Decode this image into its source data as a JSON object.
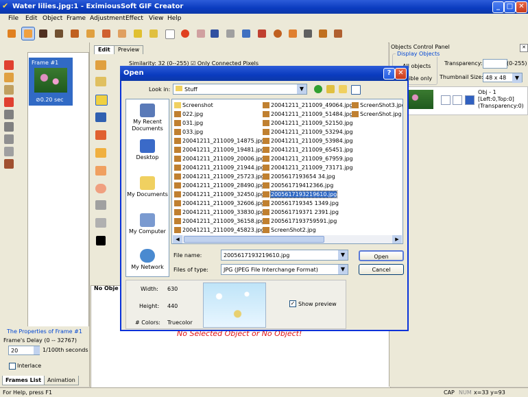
{
  "window": {
    "title": "Water lilies.jpg:1 - EximiousSoft GIF Creator"
  },
  "menu": [
    "File",
    "Edit",
    "Object",
    "Frame",
    "Adjustment",
    "Effect",
    "View",
    "Help"
  ],
  "toolbar": {
    "icons": [
      "arrow-icon",
      "select-icon",
      "save-icon",
      "open-icon",
      "paint-icon",
      "fill-icon",
      "brush-icon",
      "eraser-icon",
      "wand-icon",
      "lasso-icon",
      "delete-icon",
      "stop-icon",
      "export-icon",
      "settings-icon",
      "figure-icon",
      "fire-icon",
      "ball-icon",
      "person-icon",
      "image-icon",
      "cube-icon",
      "puzzle-icon"
    ]
  },
  "frames": {
    "items": [
      {
        "label": "Frame #1",
        "delay": "0.20 sec"
      }
    ]
  },
  "frame_props": {
    "title": "The Properties of Frame #1",
    "delay_label": "Frame's Delay (0 -- 32767)",
    "delay_value": "20",
    "delay_units": "1/100th seconds",
    "interlace_label": "Interlace"
  },
  "bottom_tabs": [
    "Frames List",
    "Animation"
  ],
  "center": {
    "tabs": [
      "Edit",
      "Preview"
    ],
    "similarity_label": "Similarity:",
    "similarity_value": "32",
    "similarity_range": "(0--255)",
    "connected_label": "Only Connected Pixels",
    "no_object_tab": "No Obje",
    "no_object_msg": "No Selected Object or No Object!"
  },
  "right_panel": {
    "title": "Objects Control Panel",
    "display_group": "Display Objects",
    "all_objects": "All objects",
    "visible_only": "sible only",
    "transparency_label": "Transparency:",
    "transparency_range": "(0-255)",
    "thumb_label": "Thumbnail Size:",
    "thumb_value": "48 x 48",
    "object": {
      "name": "Obj - 1",
      "pos": "[Left:0,Top:0]",
      "trans": "(Transparency:0)"
    }
  },
  "status": {
    "help": "For Help, press F1",
    "cap": "CAP",
    "num": "NUM",
    "coords": "x=33 y=93"
  },
  "dialog": {
    "title": "Open",
    "look_in_label": "Look in:",
    "look_in_value": "Stuff",
    "places": [
      "My Recent Documents",
      "Desktop",
      "My Documents",
      "My Computer",
      "My Network"
    ],
    "columns": [
      [
        {
          "name": "Screenshot",
          "type": "folder"
        },
        {
          "name": "022.jpg",
          "type": "jpg"
        },
        {
          "name": "031.jpg",
          "type": "jpg"
        },
        {
          "name": "033.jpg",
          "type": "jpg"
        },
        {
          "name": "20041211_211009_14875.jpg",
          "type": "jpg"
        },
        {
          "name": "20041211_211009_19481.jpg",
          "type": "jpg"
        },
        {
          "name": "20041211_211009_20006.jpg",
          "type": "jpg"
        },
        {
          "name": "20041211_211009_21944.jpg",
          "type": "jpg"
        },
        {
          "name": "20041211_211009_25723.jpg",
          "type": "jpg"
        },
        {
          "name": "20041211_211009_28490.jpg",
          "type": "jpg"
        },
        {
          "name": "20041211_211009_32450.jpg",
          "type": "jpg"
        },
        {
          "name": "20041211_211009_32606.jpg",
          "type": "jpg"
        },
        {
          "name": "20041211_211009_33830.jpg",
          "type": "jpg"
        },
        {
          "name": "20041211_211009_36158.jpg",
          "type": "jpg"
        },
        {
          "name": "20041211_211009_45823.jpg",
          "type": "jpg"
        }
      ],
      [
        {
          "name": "20041211_211009_49064.jpg",
          "type": "jpg"
        },
        {
          "name": "20041211_211009_51484.jpg",
          "type": "jpg"
        },
        {
          "name": "20041211_211009_52150.jpg",
          "type": "jpg"
        },
        {
          "name": "20041211_211009_53294.jpg",
          "type": "jpg"
        },
        {
          "name": "20041211_211009_53984.jpg",
          "type": "jpg"
        },
        {
          "name": "20041211_211009_65451.jpg",
          "type": "jpg"
        },
        {
          "name": "20041211_211009_67959.jpg",
          "type": "jpg"
        },
        {
          "name": "20041211_211009_73171.jpg",
          "type": "jpg"
        },
        {
          "name": "2005617193654 34.jpg",
          "type": "jpg"
        },
        {
          "name": "200561719412366.jpg",
          "type": "jpg"
        },
        {
          "name": "2005617193219610.jpg",
          "type": "jpg",
          "selected": true
        },
        {
          "name": "200561719345 1349.jpg",
          "type": "jpg"
        },
        {
          "name": "200561719371 2391.jpg",
          "type": "jpg"
        },
        {
          "name": "2005617193759591.jpg",
          "type": "jpg"
        },
        {
          "name": "ScreenShot2.jpg",
          "type": "jpg"
        }
      ],
      [
        {
          "name": "ScreenShot3.jpg",
          "type": "jpg"
        },
        {
          "name": "ScreenShot.jpg",
          "type": "jpg"
        }
      ]
    ],
    "file_name_label": "File name:",
    "file_name_value": "2005617193219610.jpg",
    "files_of_type_label": "Files of type:",
    "files_of_type_value": "JPG (JPEG File Interchange Format)",
    "open_btn": "Open",
    "cancel_btn": "Cancel",
    "width_label": "Width:",
    "width_value": "630",
    "height_label": "Height:",
    "height_value": "440",
    "colors_label": "# Colors:",
    "colors_value": "Truecolor",
    "show_preview": "Show preview"
  }
}
